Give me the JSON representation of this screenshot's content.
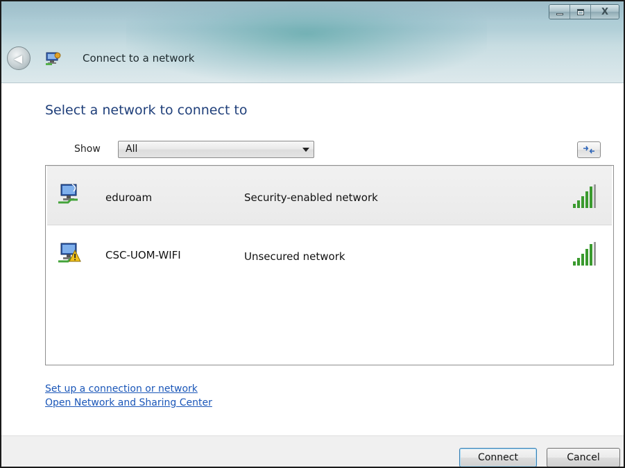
{
  "window": {
    "title": "Connect to a network",
    "controls": [
      "minimize",
      "maximize",
      "close"
    ]
  },
  "main": {
    "heading": "Select a network to connect to",
    "show_label": "Show",
    "show_value": "All"
  },
  "networks": [
    {
      "name": "eduroam",
      "security": "Security-enabled network",
      "icon": "secured-network-icon",
      "signal": "full",
      "selected": true
    },
    {
      "name": "CSC-UOM-WIFI",
      "security": "Unsecured network",
      "icon": "unsecured-network-icon",
      "signal": "full",
      "selected": false
    }
  ],
  "links": {
    "setup": "Set up a connection or network",
    "sharing_center": "Open Network and Sharing Center"
  },
  "buttons": {
    "connect": "Connect",
    "cancel": "Cancel"
  },
  "colors": {
    "heading": "#1f3f7a",
    "link": "#1a56b8",
    "signal_bar": "#3a9a2e"
  }
}
